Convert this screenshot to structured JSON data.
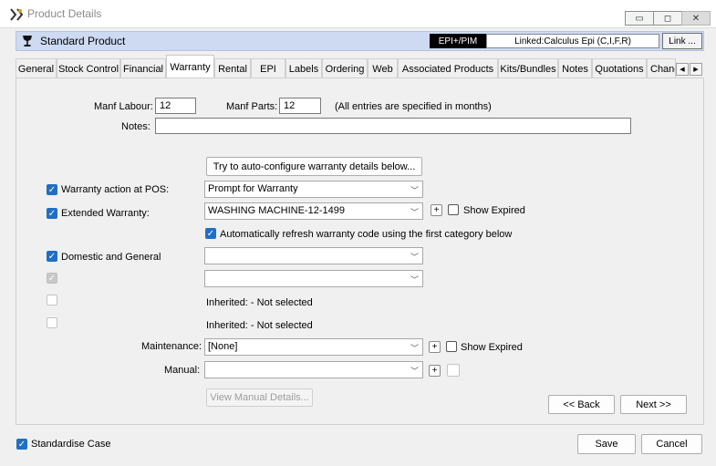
{
  "window": {
    "title": "Product Details",
    "controls": {
      "minimize": "▭",
      "maximize": "◻",
      "close": "✕"
    }
  },
  "product_bar": {
    "title": "Standard Product",
    "badge": "EPI+/PIM",
    "linked": "Linked:Calculus Epi (C,I,F,R)",
    "link_button": "Link ..."
  },
  "tabs": [
    {
      "label": "General"
    },
    {
      "label": "Stock Control"
    },
    {
      "label": "Financial"
    },
    {
      "label": "Warranty",
      "active": true
    },
    {
      "label": "Rental"
    },
    {
      "label": "EPI"
    },
    {
      "label": "Labels"
    },
    {
      "label": "Ordering"
    },
    {
      "label": "Web"
    },
    {
      "label": "Associated Products"
    },
    {
      "label": "Kits/Bundles"
    },
    {
      "label": "Notes"
    },
    {
      "label": "Quotations"
    },
    {
      "label": "Chang"
    }
  ],
  "tab_scroll": {
    "left": "◀",
    "right": "▶"
  },
  "warranty": {
    "manf_labour_label": "Manf Labour:",
    "manf_labour_value": "12",
    "manf_parts_label": "Manf Parts:",
    "manf_parts_value": "12",
    "months_note": "(All entries are specified in months)",
    "notes_label": "Notes:",
    "notes_value": "",
    "auto_config_button": "Try to auto-configure warranty details below...",
    "pos_action_label": "Warranty action at POS:",
    "pos_action_value": "Prompt for Warranty",
    "extended_label": "Extended Warranty:",
    "extended_value": "WASHING MACHINE-12-1499",
    "show_expired_label": "Show Expired",
    "auto_refresh_label": "Automatically refresh warranty code using the first category below",
    "domestic_label": "Domestic and General",
    "domestic_value": "",
    "second_category_value": "",
    "inherited_1": "Inherited: - Not selected",
    "inherited_2": "Inherited: - Not selected",
    "maintenance_label": "Maintenance:",
    "maintenance_value": "[None]",
    "maintenance_show_expired_label": "Show Expired",
    "manual_label": "Manual:",
    "manual_value": "",
    "view_manual_button": "View Manual Details...",
    "back_button": "<< Back",
    "next_button": "Next >>"
  },
  "footer": {
    "standardise_label": "Standardise Case",
    "save_button": "Save",
    "cancel_button": "Cancel"
  },
  "icons": {
    "checkmark": "✓",
    "plus": "+",
    "dropdown": "﹀"
  },
  "colors": {
    "checkbox_accent": "#1f6fc5",
    "product_bar": "#cddaf2",
    "badge_bg": "#000000"
  }
}
